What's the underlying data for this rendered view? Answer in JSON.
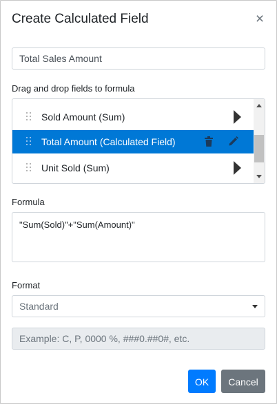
{
  "dialog": {
    "title": "Create Calculated Field",
    "close_glyph": "×"
  },
  "field_name": {
    "value": "Total Sales Amount"
  },
  "fields_section": {
    "label": "Drag and drop fields to formula",
    "items": [
      {
        "label": "Sold Amount (Sum)",
        "selected": false,
        "action_icon": "arrow-right-icon"
      },
      {
        "label": "Total Amount (Calculated Field)",
        "selected": true,
        "action_icons": [
          "trash-icon",
          "pencil-icon"
        ]
      },
      {
        "label": "Unit Sold (Sum)",
        "selected": false,
        "action_icon": "arrow-right-icon"
      }
    ]
  },
  "formula": {
    "label": "Formula",
    "value": "\"Sum(Sold)\"+\"Sum(Amount)\""
  },
  "format": {
    "label": "Format",
    "selected": "Standard",
    "custom_placeholder": "Example: C, P, 0000 %, ###0.##0#, etc."
  },
  "buttons": {
    "ok_label": "OK",
    "cancel_label": "Cancel"
  },
  "colors": {
    "accent": "#0078d6",
    "ok_button": "#007bff",
    "cancel_button": "#6c757d"
  }
}
